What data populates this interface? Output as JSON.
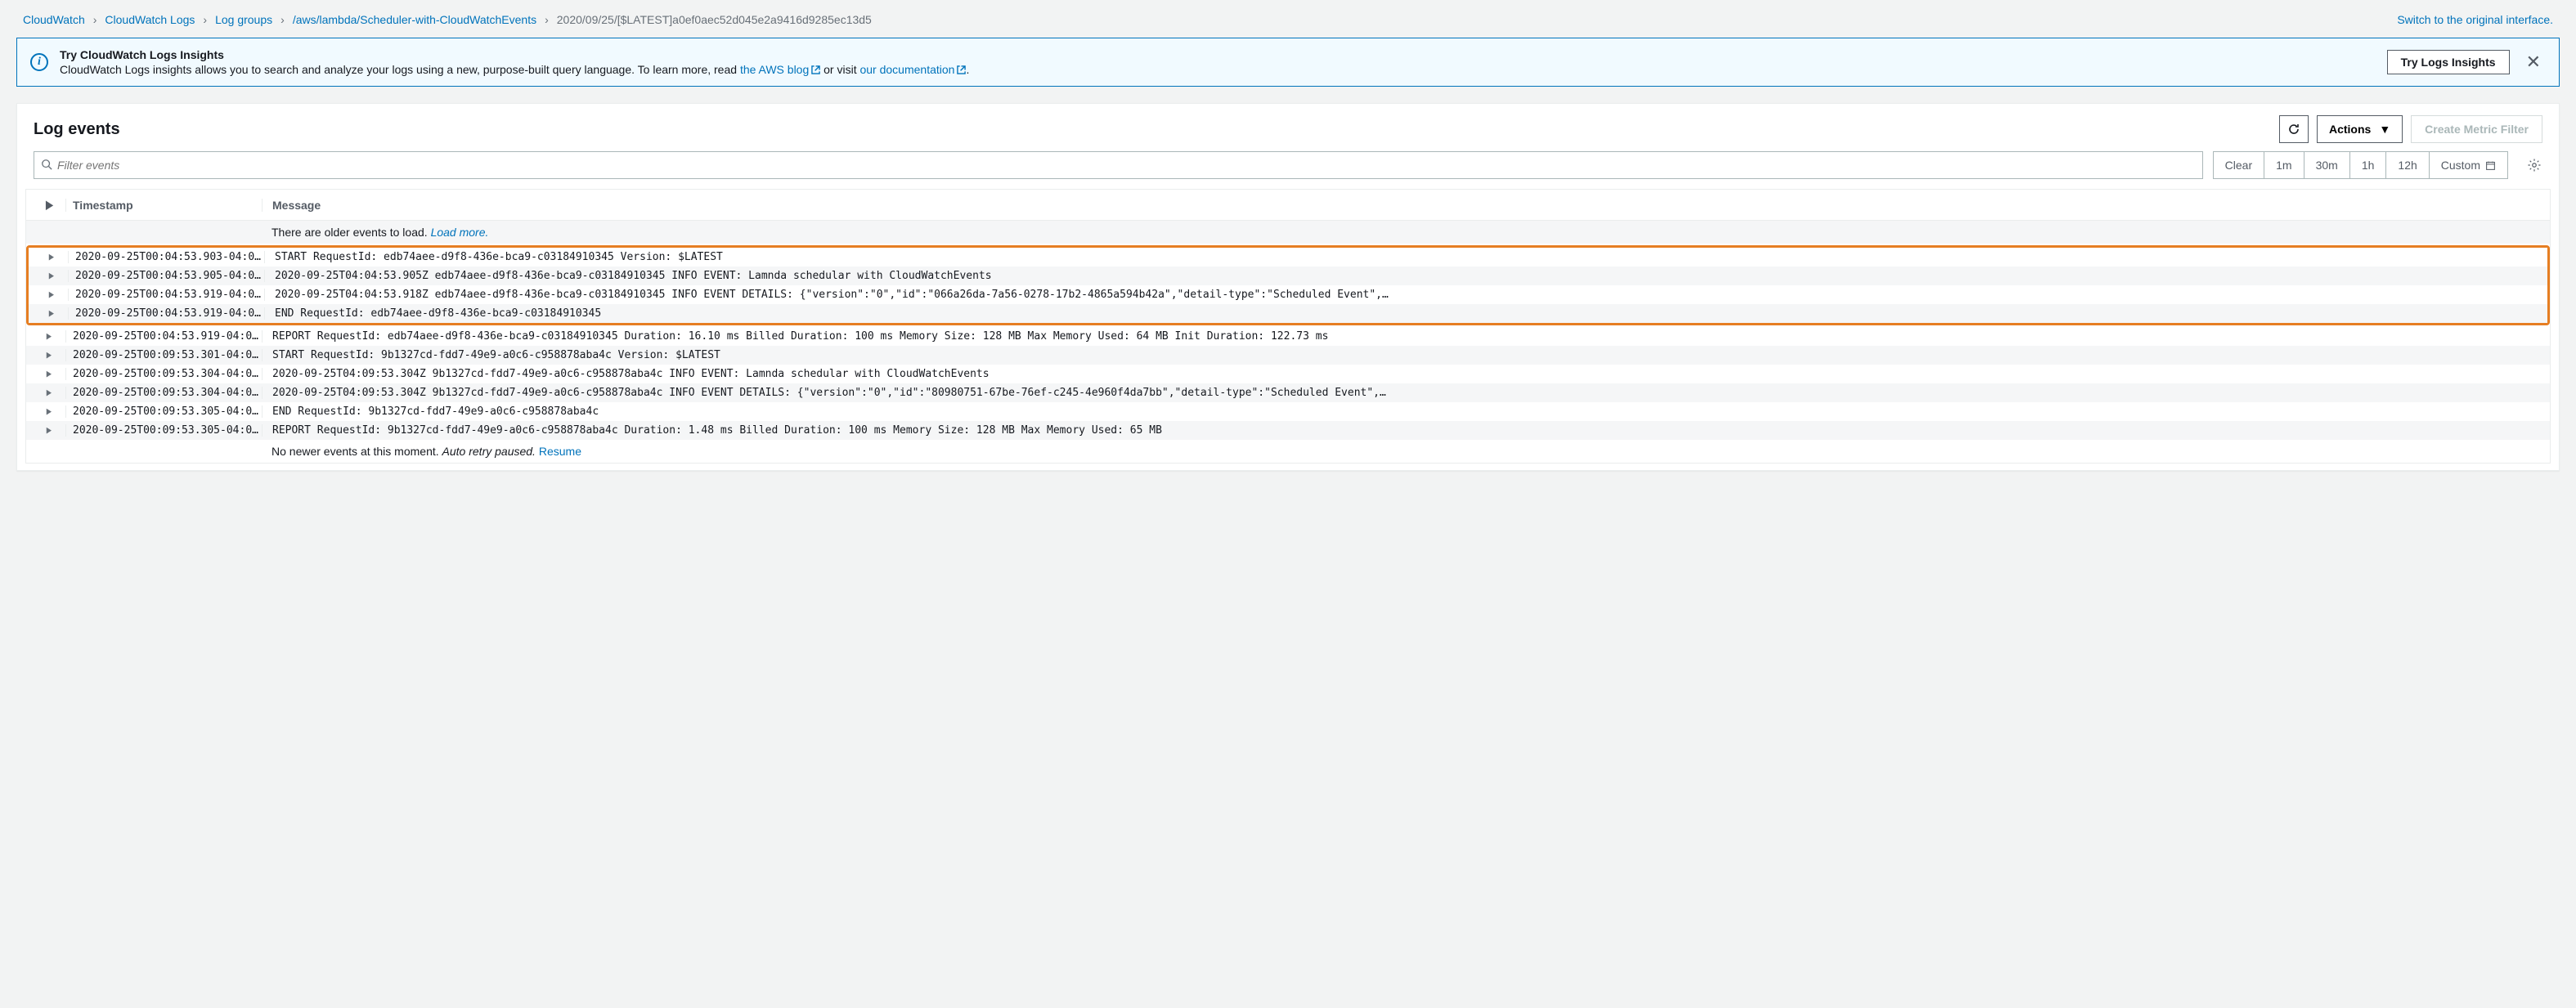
{
  "topbar": {
    "breadcrumbs": [
      {
        "label": "CloudWatch"
      },
      {
        "label": "CloudWatch Logs"
      },
      {
        "label": "Log groups"
      },
      {
        "label": "/aws/lambda/Scheduler-with-CloudWatchEvents"
      }
    ],
    "current": "2020/09/25/[$LATEST]a0ef0aec52d045e2a9416d9285ec13d5",
    "switch_link": "Switch to the original interface."
  },
  "banner": {
    "title": "Try CloudWatch Logs Insights",
    "sub_pre": "CloudWatch Logs insights allows you to search and analyze your logs using a new, purpose-built query language. To learn more, read ",
    "blog_link": "the AWS blog",
    "sub_mid": " or visit ",
    "doc_link": "our documentation",
    "sub_post": ".",
    "button": "Try Logs Insights"
  },
  "panel": {
    "title": "Log events",
    "actions_label": "Actions",
    "create_filter": "Create Metric Filter"
  },
  "search": {
    "placeholder": "Filter events",
    "clear": "Clear",
    "r1m": "1m",
    "r30m": "30m",
    "r1h": "1h",
    "r12h": "12h",
    "custom": "Custom"
  },
  "table": {
    "headers": {
      "timestamp": "Timestamp",
      "message": "Message"
    },
    "older_text": "There are older events to load. ",
    "older_link": "Load more.",
    "newer_text": "No newer events at this moment. ",
    "newer_ital": "Auto retry paused. ",
    "newer_link": "Resume",
    "rows_hl": [
      {
        "ts": "2020-09-25T00:04:53.903-04:0…",
        "msg": "START RequestId: edb74aee-d9f8-436e-bca9-c03184910345 Version: $LATEST"
      },
      {
        "ts": "2020-09-25T00:04:53.905-04:0…",
        "msg": "2020-09-25T04:04:53.905Z edb74aee-d9f8-436e-bca9-c03184910345 INFO EVENT: Lamnda schedular with CloudWatchEvents"
      },
      {
        "ts": "2020-09-25T00:04:53.919-04:0…",
        "msg": "2020-09-25T04:04:53.918Z edb74aee-d9f8-436e-bca9-c03184910345 INFO EVENT DETAILS: {\"version\":\"0\",\"id\":\"066a26da-7a56-0278-17b2-4865a594b42a\",\"detail-type\":\"Scheduled Event\",…"
      },
      {
        "ts": "2020-09-25T00:04:53.919-04:0…",
        "msg": "END RequestId: edb74aee-d9f8-436e-bca9-c03184910345"
      }
    ],
    "rows": [
      {
        "ts": "2020-09-25T00:04:53.919-04:0…",
        "msg": "REPORT RequestId: edb74aee-d9f8-436e-bca9-c03184910345 Duration: 16.10 ms Billed Duration: 100 ms Memory Size: 128 MB Max Memory Used: 64 MB Init Duration: 122.73 ms"
      },
      {
        "ts": "2020-09-25T00:09:53.301-04:0…",
        "msg": "START RequestId: 9b1327cd-fdd7-49e9-a0c6-c958878aba4c Version: $LATEST"
      },
      {
        "ts": "2020-09-25T00:09:53.304-04:0…",
        "msg": "2020-09-25T04:09:53.304Z 9b1327cd-fdd7-49e9-a0c6-c958878aba4c INFO EVENT: Lamnda schedular with CloudWatchEvents"
      },
      {
        "ts": "2020-09-25T00:09:53.304-04:0…",
        "msg": "2020-09-25T04:09:53.304Z 9b1327cd-fdd7-49e9-a0c6-c958878aba4c INFO EVENT DETAILS: {\"version\":\"0\",\"id\":\"80980751-67be-76ef-c245-4e960f4da7bb\",\"detail-type\":\"Scheduled Event\",…"
      },
      {
        "ts": "2020-09-25T00:09:53.305-04:0…",
        "msg": "END RequestId: 9b1327cd-fdd7-49e9-a0c6-c958878aba4c"
      },
      {
        "ts": "2020-09-25T00:09:53.305-04:0…",
        "msg": "REPORT RequestId: 9b1327cd-fdd7-49e9-a0c6-c958878aba4c Duration: 1.48 ms Billed Duration: 100 ms Memory Size: 128 MB Max Memory Used: 65 MB"
      }
    ]
  }
}
